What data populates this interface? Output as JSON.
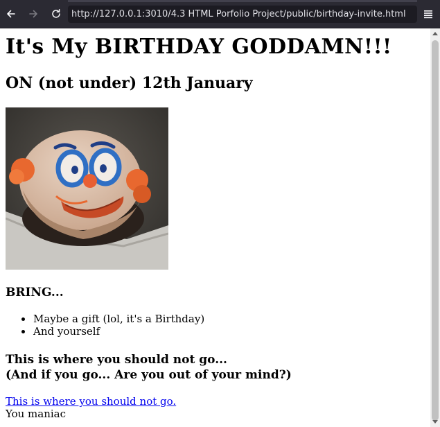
{
  "browser": {
    "url": "http://127.0.0.1:3010/4.3 HTML Porfolio Project/public/birthday-invite.html",
    "icons": [
      "back-arrow-icon",
      "forward-arrow-icon",
      "reload-icon",
      "hamburger-menu-icon"
    ]
  },
  "page": {
    "heading": "It's My BIRTHDAY GODDAMN!!!",
    "date": "ON (not under) 12th January",
    "image": {
      "subject": "clown face cake",
      "colors": {
        "frosting": "#d9b9a3",
        "blue": "#2f6fc4",
        "orange": "#e8682f",
        "tray": "#c9c7c2"
      }
    },
    "bring": {
      "heading": "BRING...",
      "items": [
        "Maybe a gift (lol, it's a Birthday)",
        "And yourself"
      ]
    },
    "warning": {
      "line1": "This is where you should not go...",
      "line2": "(And if you go... Are you out of your mind?)"
    },
    "link_text": "This is where you should not go.",
    "footer_text": "You maniac"
  }
}
